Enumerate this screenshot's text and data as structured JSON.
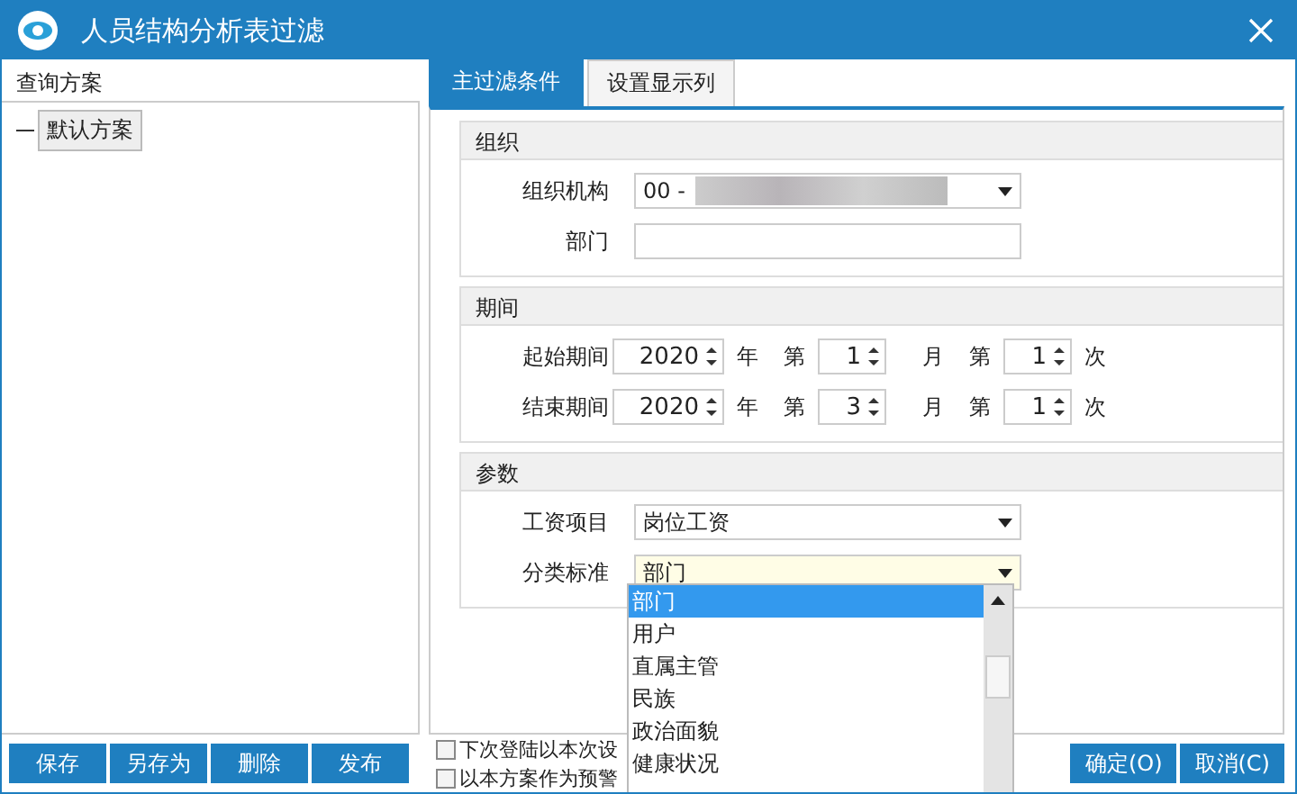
{
  "window": {
    "title": "人员结构分析表过滤"
  },
  "schemes": {
    "heading": "查询方案",
    "items": [
      {
        "label": "默认方案",
        "selected": true
      }
    ]
  },
  "tabs": [
    {
      "label": "主过滤条件",
      "selected": true
    },
    {
      "label": "设置显示列",
      "selected": false
    }
  ],
  "groups": [
    {
      "title": "组织",
      "fields": [
        {
          "kind": "select",
          "label": "组织机构",
          "value": "00 -",
          "redacted": true
        },
        {
          "kind": "text",
          "label": "部门"
        }
      ]
    },
    {
      "title": "期间",
      "fields": [
        {
          "kind": "period",
          "label": "起始期间",
          "year": "2020",
          "year_unit": "年",
          "month_prefix": "第",
          "month": "1",
          "month_unit": "月",
          "index_prefix": "第",
          "index": "1",
          "index_unit": "次"
        },
        {
          "kind": "period",
          "label": "结束期间",
          "year": "2020",
          "year_unit": "年",
          "month_prefix": "第",
          "month": "3",
          "month_unit": "月",
          "index_prefix": "第",
          "index": "1",
          "index_unit": "次"
        }
      ]
    },
    {
      "title": "参数",
      "fields": [
        {
          "kind": "select",
          "label": "工资项目",
          "value": "岗位工资"
        },
        {
          "kind": "select",
          "label": "分类标准",
          "value": "部门",
          "focused": true,
          "open": true
        }
      ]
    }
  ],
  "dropdown": {
    "options": [
      {
        "label": "部门",
        "selected": true
      },
      {
        "label": "用户",
        "selected": false
      },
      {
        "label": "直属主管",
        "selected": false
      },
      {
        "label": "民族",
        "selected": false
      },
      {
        "label": "政治面貌",
        "selected": false
      },
      {
        "label": "健康状况",
        "selected": false
      }
    ]
  },
  "scheme_buttons": [
    "保存",
    "另存为",
    "删除",
    "发布"
  ],
  "checkboxes": [
    {
      "label": "下次登陆以本次设",
      "checked": false
    },
    {
      "label": "以本方案作为预警",
      "checked": false
    }
  ],
  "actions": [
    "确定(O)",
    "取消(C)"
  ]
}
